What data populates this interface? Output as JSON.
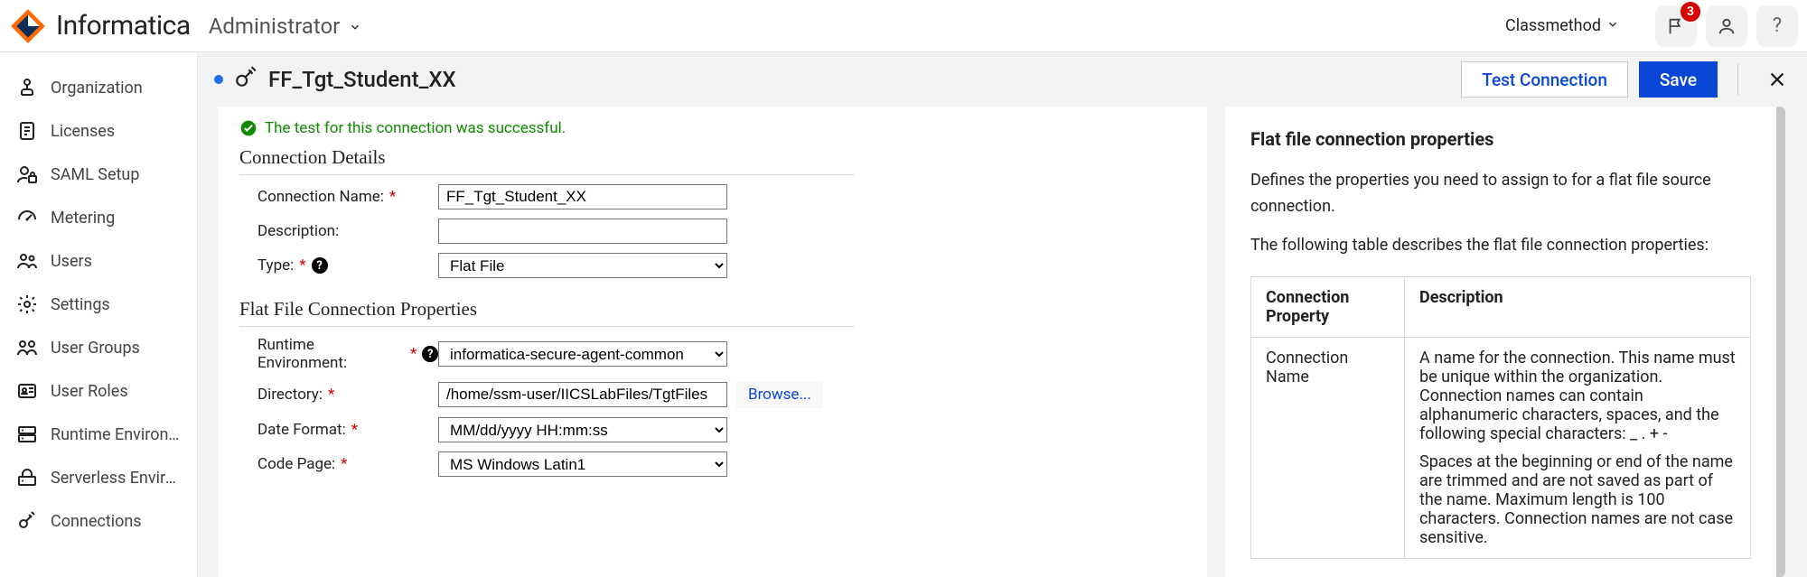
{
  "header": {
    "brand": "Informatica",
    "app": "Administrator",
    "org": "Classmethod",
    "notif_count": "3"
  },
  "sidebar": {
    "items": [
      {
        "label": "Organization"
      },
      {
        "label": "Licenses"
      },
      {
        "label": "SAML Setup"
      },
      {
        "label": "Metering"
      },
      {
        "label": "Users"
      },
      {
        "label": "Settings"
      },
      {
        "label": "User Groups"
      },
      {
        "label": "User Roles"
      },
      {
        "label": "Runtime Environ…"
      },
      {
        "label": "Serverless Enviro…"
      },
      {
        "label": "Connections"
      }
    ]
  },
  "page": {
    "title": "FF_Tgt_Student_XX",
    "test_btn": "Test Connection",
    "save_btn": "Save"
  },
  "banner": {
    "success": "The test for this connection was successful."
  },
  "form": {
    "section1": "Connection Details",
    "section2": "Flat File Connection Properties",
    "conn_name_label": "Connection Name:",
    "conn_name_value": "FF_Tgt_Student_XX",
    "desc_label": "Description:",
    "desc_value": "",
    "type_label": "Type:",
    "type_value": "Flat File",
    "rt_label": "Runtime Environment:",
    "rt_value": "informatica-secure-agent-common",
    "dir_label": "Directory:",
    "dir_value": "/home/ssm-user/IICSLabFiles/TgtFiles",
    "browse": "Browse...",
    "date_label": "Date Format:",
    "date_value": "MM/dd/yyyy HH:mm:ss",
    "cp_label": "Code Page:",
    "cp_value": "MS Windows Latin1"
  },
  "help": {
    "title": "Flat file connection properties",
    "p1": "Defines the properties you need to assign to for a flat file source connection.",
    "p2": "The following table describes the flat file connection properties:",
    "th1": "Connection Property",
    "th2": "Description",
    "row1_c1": "Connection Name",
    "row1_c2a": "A name for the connection. This name must be unique within the organization. Connection names can contain alphanumeric characters, spaces, and the following special characters: _ . + -",
    "row1_c2b": "Spaces at the beginning or end of the name are trimmed and are not saved as part of the name. Maximum length is 100 characters. Connection names are not case sensitive."
  }
}
